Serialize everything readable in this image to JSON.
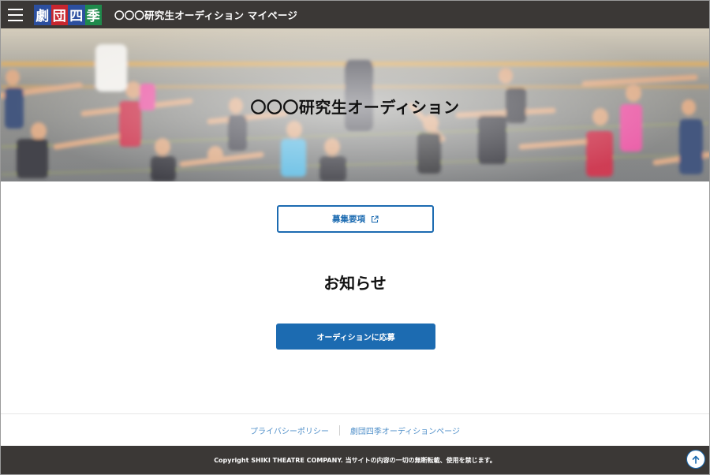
{
  "header": {
    "logo_chars": [
      "劇",
      "団",
      "四",
      "季"
    ],
    "logo_colors": [
      "#2c4f9f",
      "#c8262e",
      "#2c4f9f",
      "#1f8a4c"
    ],
    "title": "〇〇〇研究生オーディション マイページ",
    "menu_icon": "hamburger-icon"
  },
  "hero": {
    "title": "〇〇〇研究生オーディション"
  },
  "main": {
    "guidelines_label": "募集要項",
    "guidelines_icon": "external-link-icon",
    "news_heading": "お知らせ",
    "apply_label": "オーディションに応募"
  },
  "footer": {
    "links": [
      "プライバシーポリシー",
      "劇団四季オーディションページ"
    ],
    "copyright": "Copyright SHIKI THEATRE COMPANY. 当サイトの内容の一切の無断転載、使用を禁じます。",
    "top_icon": "arrow-up-icon"
  },
  "colors": {
    "header_bg": "#3b3836",
    "accent": "#1c6bb1",
    "link": "#4f8fc9"
  }
}
